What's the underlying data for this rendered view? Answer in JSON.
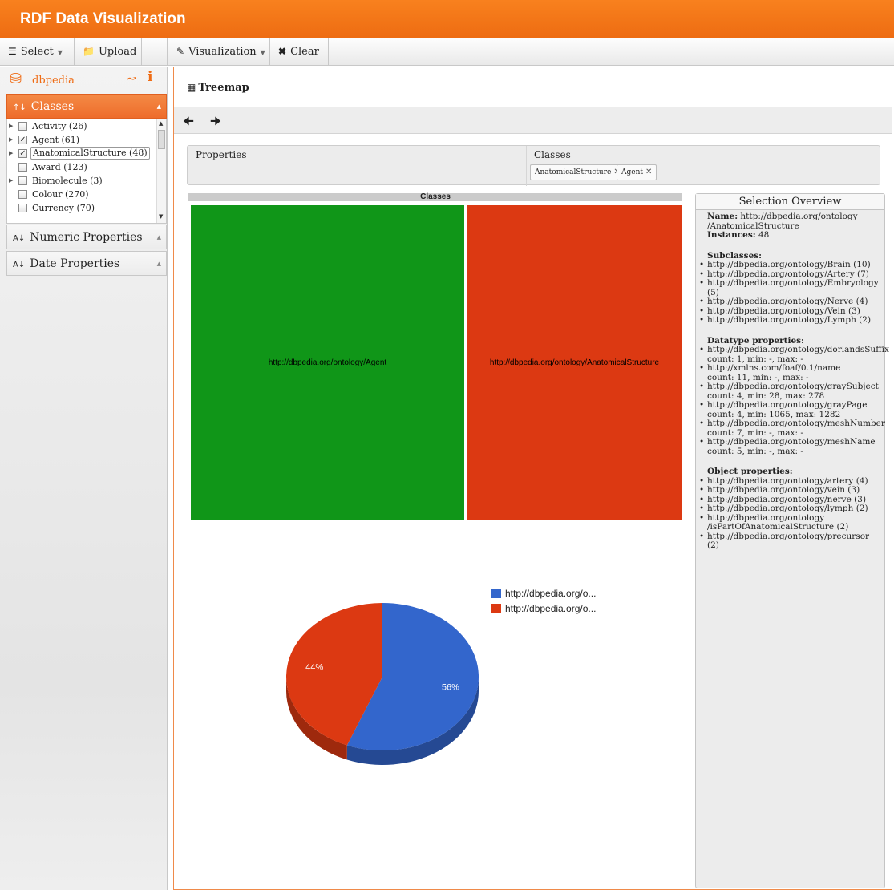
{
  "app": {
    "title": "RDF Data Visualization"
  },
  "toolbar": {
    "select_label": "Select",
    "upload_label": "Upload",
    "visualization_label": "Visualization",
    "clear_label": "Clear"
  },
  "sidebar": {
    "dataset": "dbpedia",
    "classes_header": "Classes",
    "classes": [
      {
        "label": "Activity (26)",
        "checked": false,
        "expandable": true
      },
      {
        "label": "Agent (61)",
        "checked": true,
        "expandable": true
      },
      {
        "label": "AnatomicalStructure (48)",
        "checked": true,
        "expandable": true
      },
      {
        "label": "Award (123)",
        "checked": false,
        "expandable": false
      },
      {
        "label": "Biomolecule (3)",
        "checked": false,
        "expandable": true
      },
      {
        "label": "Colour (270)",
        "checked": false,
        "expandable": false
      },
      {
        "label": "Currency (70)",
        "checked": false,
        "expandable": false
      }
    ],
    "numeric_header": "Numeric Properties",
    "date_header": "Date Properties"
  },
  "main": {
    "viz_title": "Treemap",
    "filters": {
      "properties_label": "Properties",
      "classes_label": "Classes",
      "tags": [
        "AnatomicalStructure",
        "Agent"
      ]
    },
    "treemap": {
      "header": "Classes",
      "cells": [
        {
          "label": "http://dbpedia.org/ontology/Agent",
          "color": "#109618"
        },
        {
          "label": "http://dbpedia.org/ontology/AnatomicalStructure",
          "color": "#dc3912"
        }
      ]
    },
    "pie": {
      "slices": [
        {
          "value": 56,
          "label": "56%",
          "color": "#3366cc"
        },
        {
          "value": 44,
          "label": "44%",
          "color": "#dc3912"
        }
      ],
      "legend": [
        "http://dbpedia.org/o...",
        "http://dbpedia.org/o..."
      ]
    }
  },
  "overview": {
    "title": "Selection Overview",
    "name_label": "Name:",
    "name_value": "http://dbpedia.org/ontology",
    "name_value_2": "/AnatomicalStructure",
    "instances_label": "Instances:",
    "instances_value": "48",
    "subclasses_label": "Subclasses:",
    "subclasses": [
      "http://dbpedia.org/ontology/Brain (10)",
      "http://dbpedia.org/ontology/Artery (7)",
      "http://dbpedia.org/ontology/Embryology (5)",
      "http://dbpedia.org/ontology/Nerve (4)",
      "http://dbpedia.org/ontology/Vein (3)",
      "http://dbpedia.org/ontology/Lymph (2)"
    ],
    "datatype_label": "Datatype properties:",
    "datatype": [
      {
        "name": "http://dbpedia.org/ontology/dorlandsSuffix",
        "stats": "count: 1, min: -, max: -"
      },
      {
        "name": "http://xmlns.com/foaf/0.1/name",
        "stats": "count: 11, min: -, max: -"
      },
      {
        "name": "http://dbpedia.org/ontology/graySubject",
        "stats": "count: 4, min: 28, max: 278"
      },
      {
        "name": "http://dbpedia.org/ontology/grayPage",
        "stats": "count: 4, min: 1065, max: 1282"
      },
      {
        "name": "http://dbpedia.org/ontology/meshNumber",
        "stats": "count: 7, min: -, max: -"
      },
      {
        "name": "http://dbpedia.org/ontology/meshName",
        "stats": "count: 5, min: -, max: -"
      }
    ],
    "object_label": "Object properties:",
    "object": [
      "http://dbpedia.org/ontology/artery (4)",
      "http://dbpedia.org/ontology/vein (3)",
      "http://dbpedia.org/ontology/nerve (3)",
      "http://dbpedia.org/ontology/lymph (2)",
      "http://dbpedia.org/ontology",
      "/isPartOfAnatomicalStructure (2)",
      "http://dbpedia.org/ontology/precursor (2)"
    ]
  }
}
